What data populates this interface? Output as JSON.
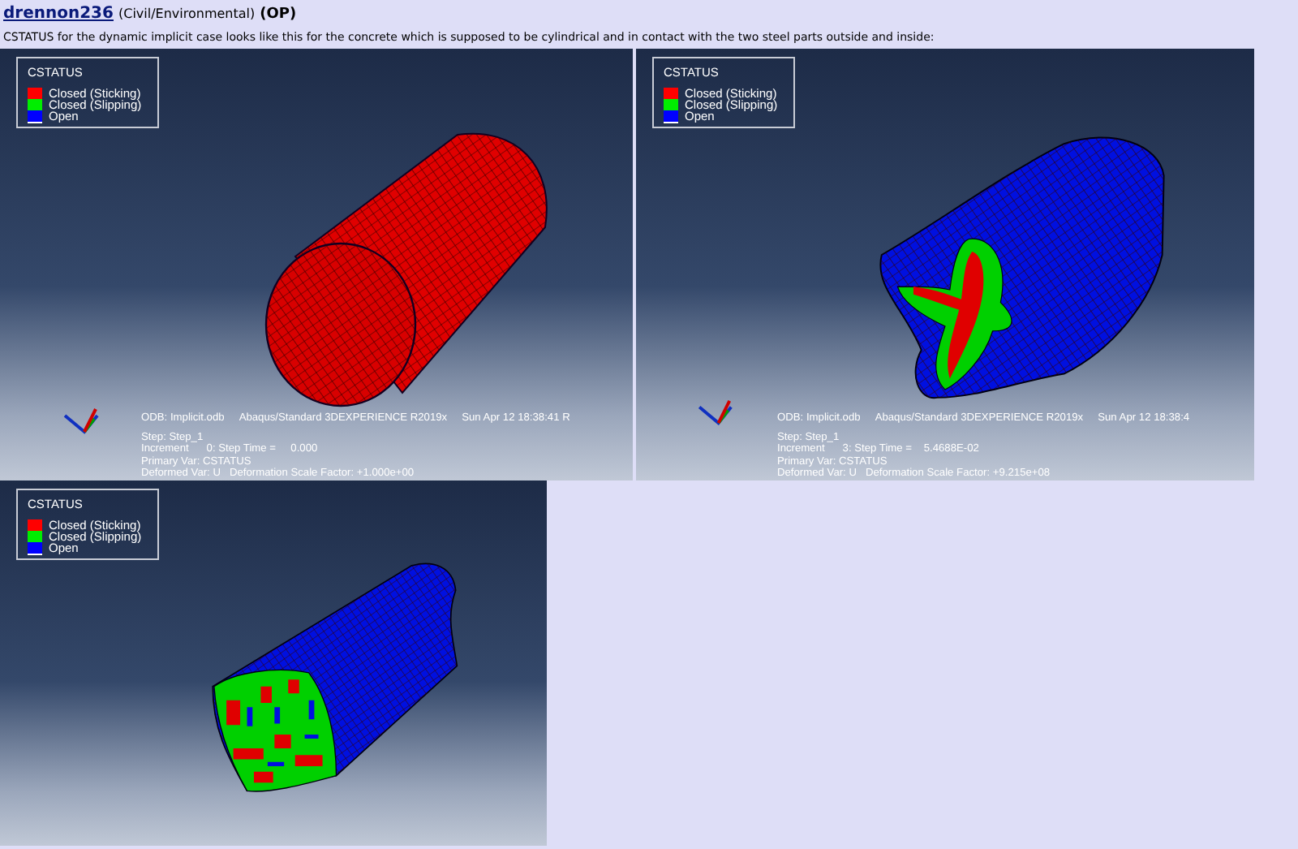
{
  "post": {
    "author": "drennon236",
    "affiliation": "(Civil/Environmental)",
    "badge": "(OP)",
    "text": "CSTATUS for the dynamic implicit case looks like this for the concrete which is supposed to be cylindrical and in contact with the two steel parts outside and inside:"
  },
  "images": [
    {
      "kind": "cylinder",
      "legend": {
        "title": "CSTATUS",
        "items": [
          {
            "label": "Closed (Sticking)",
            "color": "#ff0000"
          },
          {
            "label": "Closed (Slipping)",
            "color": "#00ee00"
          },
          {
            "label": "Open",
            "color": "#0000ff"
          }
        ]
      },
      "info": {
        "odb": "ODB: Implicit.odb",
        "solver": "Abaqus/Standard 3DEXPERIENCE R2019x",
        "date": "Sun Apr 12 18:38:41 R",
        "lines": [
          "Step: Step_1",
          "Increment      0: Step Time =     0.000",
          "Primary Var: CSTATUS",
          "Deformed Var: U   Deformation Scale Factor: +1.000e+00"
        ]
      }
    },
    {
      "kind": "deformed-cross",
      "legend": {
        "title": "CSTATUS",
        "items": [
          {
            "label": "Closed (Sticking)",
            "color": "#ff0000"
          },
          {
            "label": "Closed (Slipping)",
            "color": "#00ee00"
          },
          {
            "label": "Open",
            "color": "#0000ff"
          }
        ]
      },
      "info": {
        "odb": "ODB: Implicit.odb",
        "solver": "Abaqus/Standard 3DEXPERIENCE R2019x",
        "date": "Sun Apr 12 18:38:4",
        "lines": [
          "Step: Step_1",
          "Increment      3: Step Time =    5.4688E-02",
          "Primary Var: CSTATUS",
          "Deformed Var: U   Deformation Scale Factor: +9.215e+08"
        ]
      }
    },
    {
      "kind": "deformed-end",
      "legend": {
        "title": "CSTATUS",
        "items": [
          {
            "label": "Closed (Sticking)",
            "color": "#ff0000"
          },
          {
            "label": "Closed (Slipping)",
            "color": "#00ee00"
          },
          {
            "label": "Open",
            "color": "#0000ff"
          }
        ]
      }
    }
  ]
}
